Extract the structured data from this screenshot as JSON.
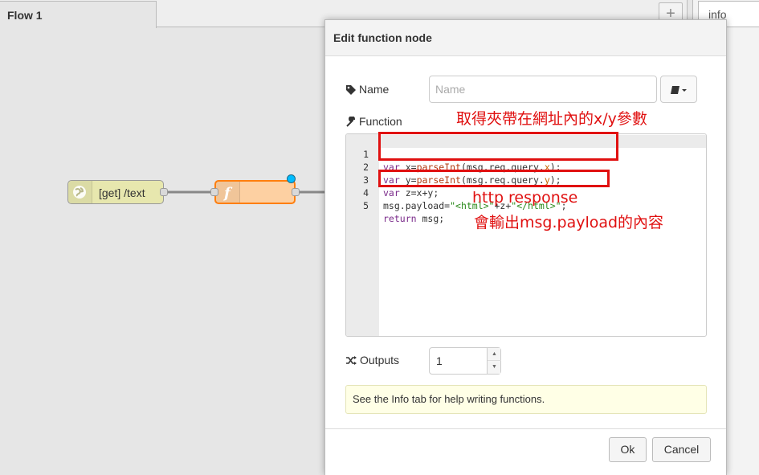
{
  "workspace": {
    "flow_tab_label": "Flow 1",
    "add_tab_label": "+",
    "sidebar_tab_label": "info"
  },
  "nodes": {
    "http_in_label": "[get] /text",
    "function_icon": "function-icon"
  },
  "dialog": {
    "title": "Edit function node",
    "name_label": "Name",
    "name_placeholder": "Name",
    "name_value": "",
    "function_label": "Function",
    "outputs_label": "Outputs",
    "outputs_value": "1",
    "tip": "See the Info tab for help writing functions.",
    "ok_label": "Ok",
    "cancel_label": "Cancel"
  },
  "code": {
    "line_numbers": [
      "1",
      "2",
      "3",
      "4",
      "5"
    ],
    "line1": {
      "kw": "var",
      "a": " x=",
      "fn": "parseInt",
      "b": "(msg.req.query.",
      "v": "x",
      "c": ");"
    },
    "line2": {
      "kw": "var",
      "a": " y=",
      "fn": "parseInt",
      "b": "(msg.req.query.",
      "v": "y",
      "c": ");"
    },
    "line3": {
      "kw": "var",
      "a": " z=x+y;"
    },
    "line4": {
      "a": "msg.payload=",
      "s1": "\"<html>\"",
      "b": "+z+",
      "s2": "\"</html>\"",
      "c": ";"
    },
    "line5": {
      "kw": "return",
      "a": " msg;"
    }
  },
  "annotations": {
    "query_note": "取得夾帶在網址內的x/y參數",
    "response_note_1": "http response",
    "response_note_2": "會輸出msg.payload的內容",
    "color": "#e01010"
  },
  "colors": {
    "function_node": "#fdd0a2",
    "function_border": "#ff7f0e",
    "http_node": "#e7e7ae",
    "changed_dot": "#00bcff",
    "tip_bg": "#ffffe6"
  }
}
